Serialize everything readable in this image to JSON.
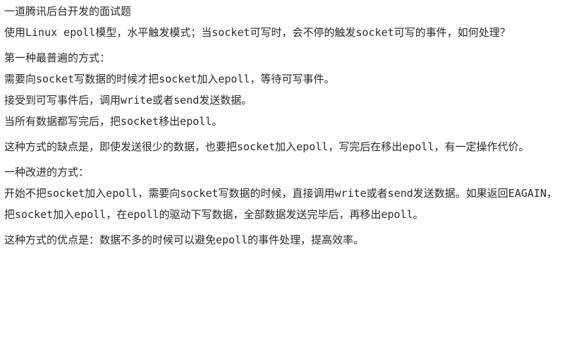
{
  "title": "一道腾讯后台开发的面试题",
  "question": "使用Linux epoll模型，水平触发模式；当socket可写时，会不停的触发socket可写的事件，如何处理？",
  "method1": {
    "heading": "第一种最普遍的方式：",
    "steps": [
      "需要向socket写数据的时候才把socket加入epoll，等待可写事件。",
      "接受到可写事件后，调用write或者send发送数据。",
      "当所有数据都写完后，把socket移出epoll。"
    ],
    "drawback": "这种方式的缺点是，即使发送很少的数据，也要把socket加入epoll，写完后在移出epoll，有一定操作代价。"
  },
  "method2": {
    "heading": "一种改进的方式：",
    "description": "开始不把socket加入epoll，需要向socket写数据的时候，直接调用write或者send发送数据。如果返回EAGAIN，把socket加入epoll，在epoll的驱动下写数据，全部数据发送完毕后，再移出epoll。",
    "advantage": "这种方式的优点是：数据不多的时候可以避免epoll的事件处理，提高效率。"
  }
}
